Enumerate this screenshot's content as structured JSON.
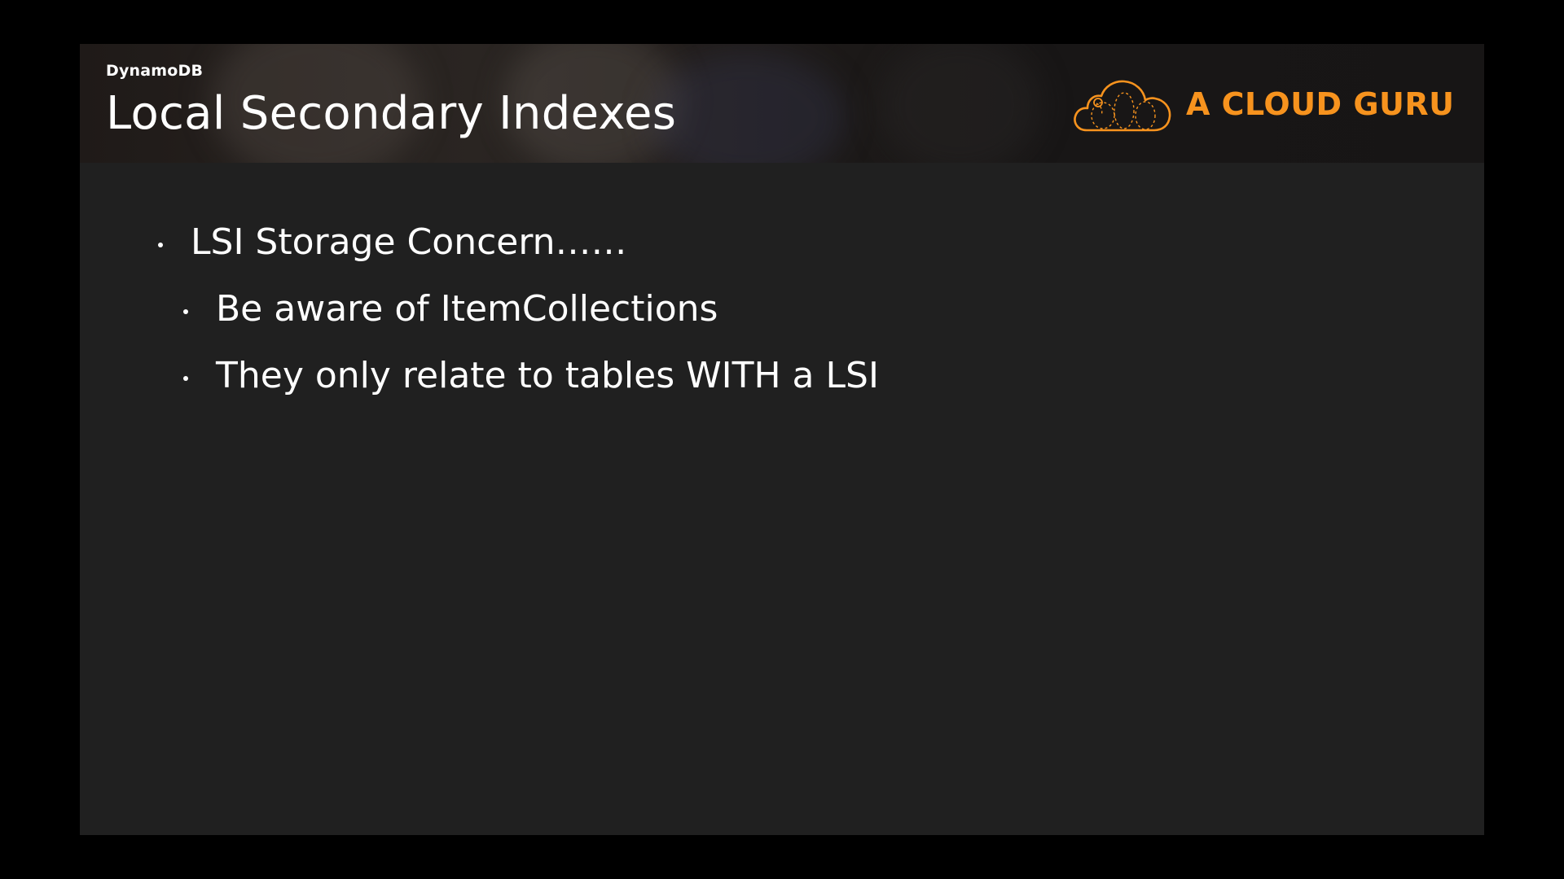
{
  "slide": {
    "section_label": "DynamoDB",
    "title": "Local Secondary Indexes",
    "brand": {
      "name": "A CLOUD GURU",
      "icon": "cloud-logo-icon",
      "color": "#f7931e"
    },
    "bullets": [
      {
        "level": 1,
        "text": "LSI Storage Concern……"
      },
      {
        "level": 2,
        "text": "Be aware of ItemCollections"
      },
      {
        "level": 2,
        "text": "They only relate to tables WITH a LSI"
      }
    ]
  },
  "colors": {
    "frame_background": "#000000",
    "slide_background": "#202020",
    "text": "#ffffff",
    "accent": "#f7931e"
  }
}
